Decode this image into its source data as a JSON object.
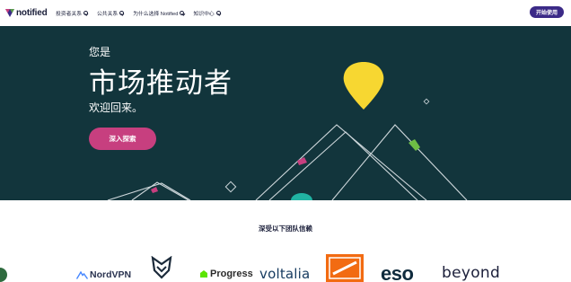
{
  "header": {
    "logo_text": "notified",
    "nav": [
      {
        "label": "投资者关系"
      },
      {
        "label": "公共关系"
      },
      {
        "label": "为什么选择 Notified"
      },
      {
        "label": "知识中心"
      }
    ],
    "cta_label": "开始使用"
  },
  "hero": {
    "eyebrow": "您是",
    "title": "市场推动者",
    "subtitle": "欢迎回来。",
    "button_label": "深入探索",
    "colors": {
      "background": "#12353c",
      "button": "#c73f7f",
      "balloon": "#f7d731",
      "lines": "#cfd8dc"
    }
  },
  "trust": {
    "title": "深受以下团队信赖",
    "logos": [
      {
        "name": "NordVPN"
      },
      {
        "name": "fox-logo"
      },
      {
        "name": "Progress"
      },
      {
        "name": "voltalia"
      },
      {
        "name": "the-home-depot-logo"
      },
      {
        "name": "eso"
      },
      {
        "name": "beyond"
      }
    ]
  },
  "colors": {
    "brand": "#3b2a87",
    "accent": "#c73f7f"
  }
}
